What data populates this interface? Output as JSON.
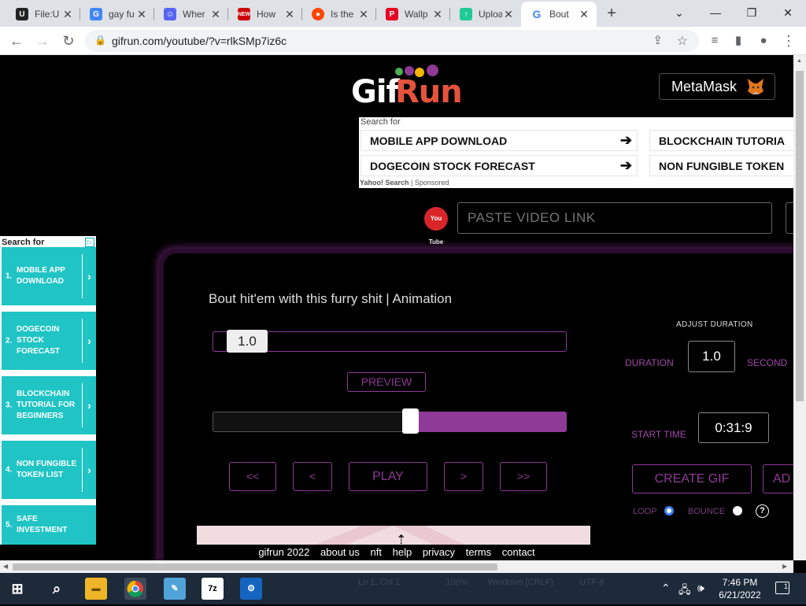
{
  "browser": {
    "tabs": [
      {
        "title": "File:U",
        "icon": "unreal-icon",
        "color": "#222222"
      },
      {
        "title": "gay fu",
        "icon": "google-icon",
        "color": "#4285f4"
      },
      {
        "title": "Wher",
        "icon": "discord-icon",
        "color": "#5865f2"
      },
      {
        "title": "How",
        "icon": "news-icon",
        "color": "#cc0000"
      },
      {
        "title": "Is the",
        "icon": "reddit-icon",
        "color": "#ff4500"
      },
      {
        "title": "Wallp",
        "icon": "pin-icon",
        "color": "#e60023"
      },
      {
        "title": "Uploa",
        "icon": "upload-icon",
        "color": "#20c997"
      },
      {
        "title": "Bout",
        "icon": "google-icon",
        "color": "#4285f4",
        "active": true
      }
    ],
    "url": "gifrun.com/youtube/?v=rlkSMp7iz6c"
  },
  "site": {
    "metamask_label": "MetaMask",
    "yahoo": {
      "search_for": "Search for",
      "links": [
        "MOBILE APP DOWNLOAD",
        "BLOCKCHAIN TUTORIA",
        "DOGECOIN STOCK FORECAST",
        "NON FUNGIBLE TOKEN"
      ],
      "footer_brand": "Yahoo! Search",
      "footer_sep": "|",
      "footer_sponsored": "Sponsored"
    },
    "youtube_icon_text": "You Tube",
    "paste_placeholder": "PASTE VIDEO LINK",
    "left_ad": {
      "search_for": "Search for",
      "items": [
        {
          "num": "1.",
          "label": "MOBILE APP DOWNLOAD"
        },
        {
          "num": "2.",
          "label": "DOGECOIN STOCK FORECAST"
        },
        {
          "num": "3.",
          "label": "BLOCKCHAIN TUTORIAL FOR BEGINNERS"
        },
        {
          "num": "4.",
          "label": "NON FUNGIBLE TOKEN LIST"
        },
        {
          "num": "5.",
          "label": "SAFE INVESTMENT"
        }
      ]
    },
    "editor": {
      "video_title": "Bout hit'em with this furry shit | Animation",
      "duration_slider_value": "1.0",
      "preview_label": "PREVIEW",
      "seek_position": 0.56,
      "controls": [
        "<<",
        "<",
        "PLAY",
        ">",
        ">>"
      ],
      "adjust_duration_label": "ADJUST DURATION",
      "duration_label": "DURATION",
      "duration_value": "1.0",
      "seconds_label": "SECOND",
      "start_time_label": "START TIME",
      "start_time_value": "0:31:9",
      "create_gif_label": "CREATE GIF",
      "add_label": "AD",
      "loop_label": "LOOP",
      "bounce_label": "BOUNCE",
      "loop_checked": true
    },
    "footer": [
      "gifrun 2022",
      "about us",
      "nft",
      "help",
      "privacy",
      "terms",
      "contact"
    ]
  },
  "taskbar": {
    "ghost_text": [
      "Ln 1, Col 1",
      "100%",
      "Windows (CRLF)",
      "UTF-8"
    ],
    "time": "7:46 PM",
    "date": "6/21/2022",
    "notifications": "1"
  }
}
